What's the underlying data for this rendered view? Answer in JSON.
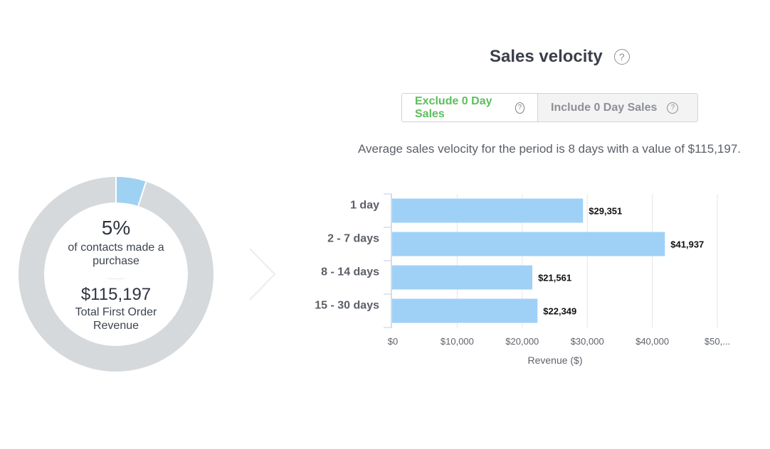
{
  "summary_panel": {
    "percent": "5%",
    "percent_label": "of contacts made a purchase",
    "revenue": "$115,197",
    "revenue_label": "Total First Order Revenue",
    "donut_fraction": 0.05,
    "colors": {
      "filled": "#9fd1f3",
      "track": "#d6d9db"
    }
  },
  "header": {
    "title": "Sales velocity",
    "help_icon": "question-circle-icon"
  },
  "toggle": {
    "options": [
      {
        "label": "Exclude 0 Day Sales",
        "active": true
      },
      {
        "label": "Include 0 Day Sales",
        "active": false
      }
    ],
    "active_color": "#5cbe5c"
  },
  "summary_text": "Average sales velocity for the period is 8 days with a value of $115,197.",
  "chart_data": {
    "type": "bar",
    "orientation": "horizontal",
    "categories": [
      "1 day",
      "2 - 7 days",
      "8 - 14 days",
      "15 - 30 days"
    ],
    "values": [
      29351,
      41937,
      21561,
      22349
    ],
    "value_labels": [
      "$29,351",
      "$41,937",
      "$21,561",
      "$22,349"
    ],
    "xlabel": "Revenue ($)",
    "ylabel": "",
    "xlim": [
      0,
      50000
    ],
    "xticks": [
      0,
      10000,
      20000,
      30000,
      40000,
      50000
    ],
    "xtick_labels": [
      "$0",
      "$10,000",
      "$20,000",
      "$30,000",
      "$40,000",
      "$50,..."
    ],
    "grid": true,
    "bar_color": "#9fd1f7",
    "title": ""
  }
}
